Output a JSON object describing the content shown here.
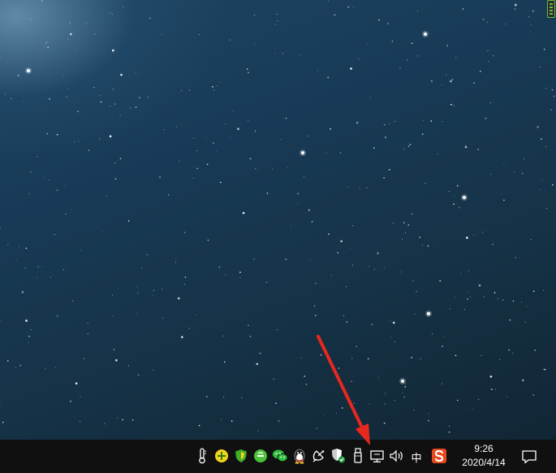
{
  "taskbar": {
    "clock": {
      "time": "9:26",
      "date": "2020/4/14"
    },
    "ime_label": "中",
    "tray_icons": [
      "thermometer-icon",
      "add-plus-icon",
      "green-shield-icon",
      "green-circle-app-icon",
      "wechat-icon",
      "qq-penguin-icon",
      "satellite-icon",
      "windows-security-icon",
      "usb-drive-icon",
      "network-monitor-icon",
      "volume-icon",
      "ime-icon",
      "sogou-input-icon",
      "notification-icon"
    ]
  },
  "colors": {
    "taskbar_bg": "#101010",
    "arrow": "#e8281e",
    "accent_green": "#6bbf3a",
    "sogou_orange": "#e8491d"
  }
}
